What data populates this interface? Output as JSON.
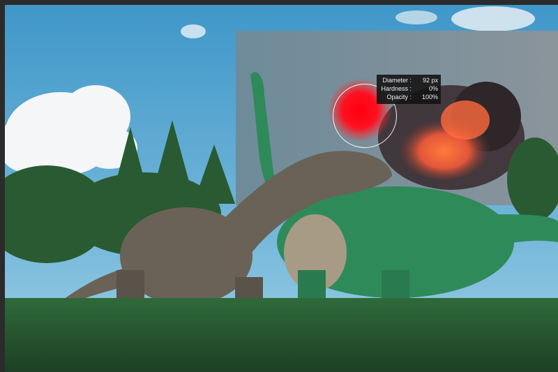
{
  "app": {
    "canvas": "dinosaurs photo composite",
    "tool": "brush"
  },
  "brush": {
    "tooltip": {
      "diameter_label": "Diameter :",
      "diameter_value": "92 px",
      "hardness_label": "Hardness :",
      "hardness_value": "0%",
      "opacity_label": "Opacity :",
      "opacity_value": "100%"
    },
    "paint_color": "#ff0010"
  },
  "colors": {
    "sky": "#4aa3cf",
    "overlay_sky": "#6a7f8e",
    "smoke": "#3b2f33",
    "fire": "#ff6a2c",
    "grass": "#2f6a3a"
  }
}
